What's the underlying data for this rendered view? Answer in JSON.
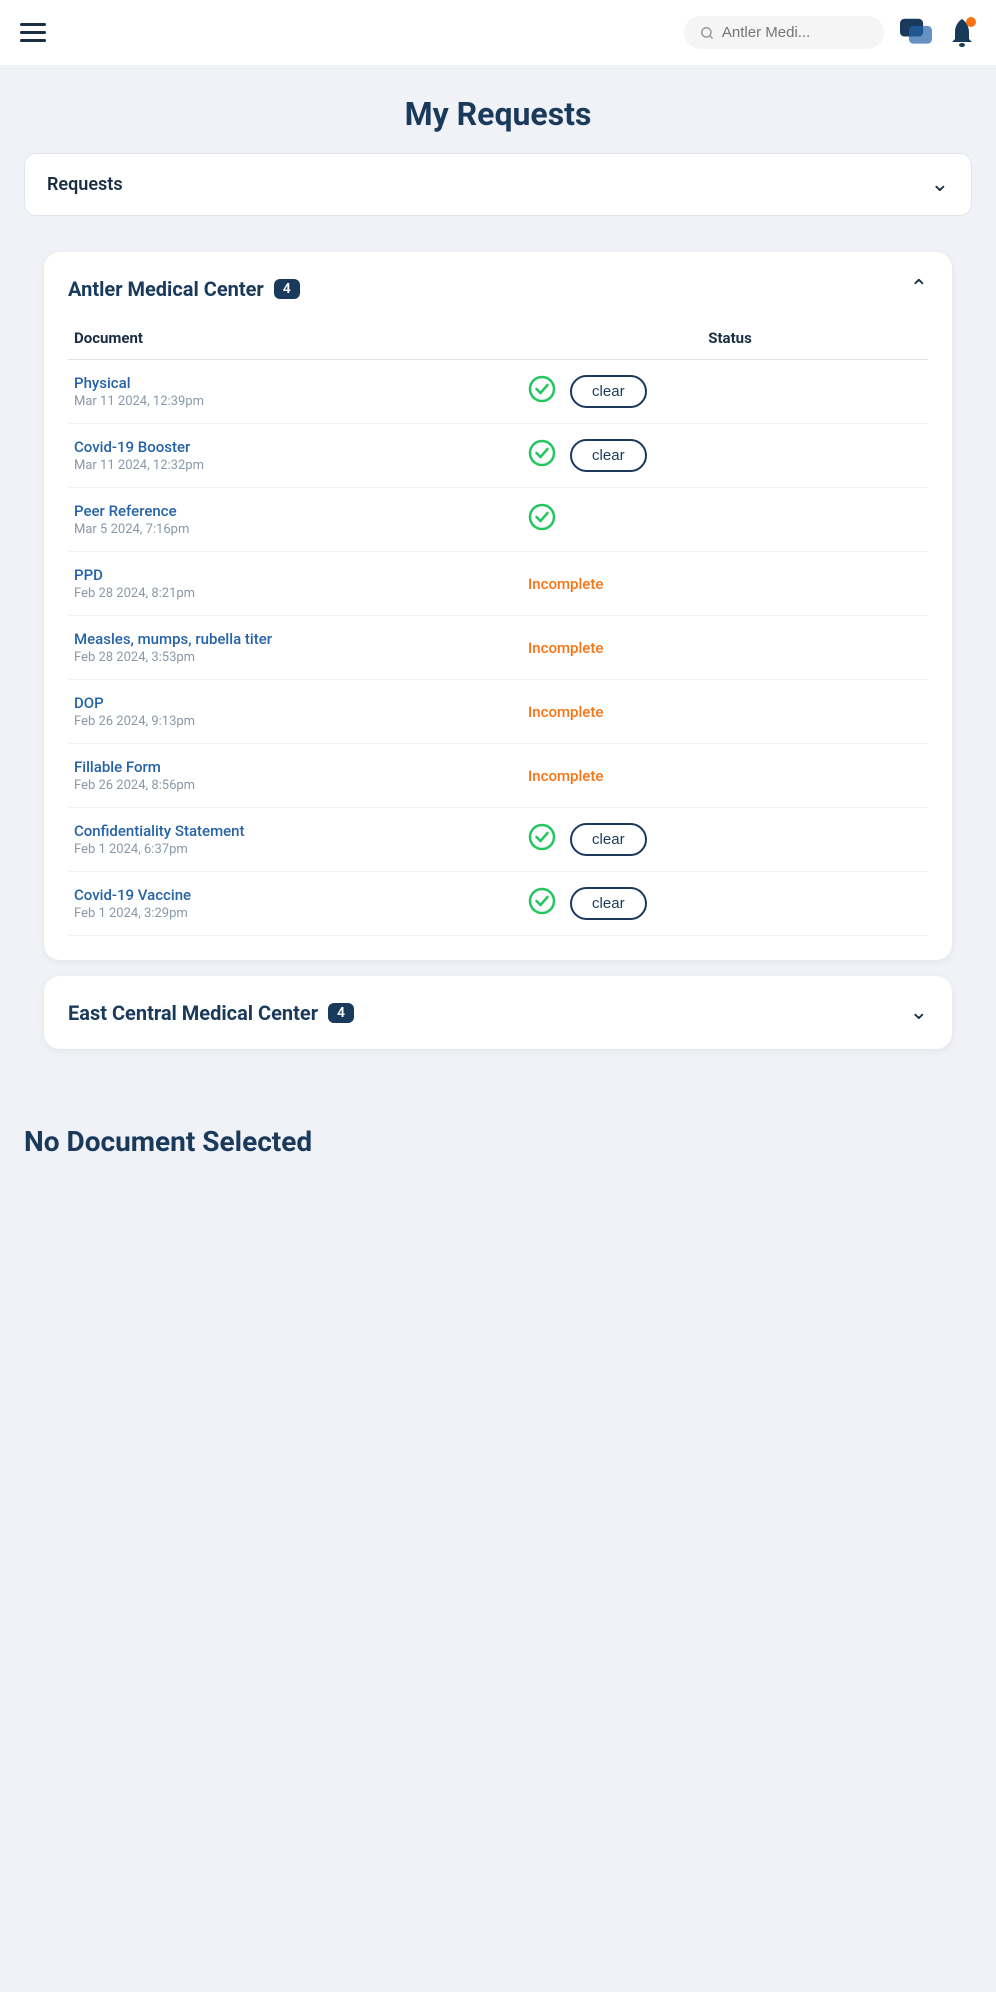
{
  "header": {
    "search_placeholder": "Antler Medi...",
    "hamburger_label": "Menu"
  },
  "page": {
    "title": "My Requests"
  },
  "requests_dropdown": {
    "label": "Requests"
  },
  "medical_centers": [
    {
      "name": "Antler Medical Center",
      "count": 4,
      "expanded": true,
      "columns": {
        "document": "Document",
        "status": "Status"
      },
      "documents": [
        {
          "name": "Physical",
          "date": "Mar 11 2024, 12:39pm",
          "status": "clear",
          "has_check": true
        },
        {
          "name": "Covid-19 Booster",
          "date": "Mar 11 2024, 12:32pm",
          "status": "clear",
          "has_check": true
        },
        {
          "name": "Peer Reference",
          "date": "Mar 5 2024, 7:16pm",
          "status": "check_only",
          "has_check": true
        },
        {
          "name": "PPD",
          "date": "Feb 28 2024, 8:21pm",
          "status": "incomplete",
          "has_check": false
        },
        {
          "name": "Measles, mumps, rubella titer",
          "date": "Feb 28 2024, 3:53pm",
          "status": "incomplete",
          "has_check": false
        },
        {
          "name": "DOP",
          "date": "Feb 26 2024, 9:13pm",
          "status": "incomplete",
          "has_check": false
        },
        {
          "name": "Fillable Form",
          "date": "Feb 26 2024, 8:56pm",
          "status": "incomplete",
          "has_check": false
        },
        {
          "name": "Confidentiality Statement",
          "date": "Feb 1 2024, 6:37pm",
          "status": "clear",
          "has_check": true
        },
        {
          "name": "Covid-19 Vaccine",
          "date": "Feb 1 2024, 3:29pm",
          "status": "clear",
          "has_check": true
        }
      ]
    },
    {
      "name": "East Central Medical Center",
      "count": 4,
      "expanded": false,
      "documents": []
    }
  ],
  "no_doc": {
    "title": "No Document Selected"
  },
  "labels": {
    "clear": "clear",
    "incomplete": "Incomplete"
  }
}
